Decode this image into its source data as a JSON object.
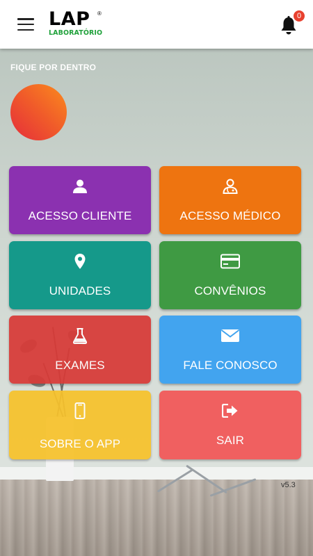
{
  "header": {
    "logo_main": "LAP",
    "logo_registered": "®",
    "logo_sub": "LABORATÓRIO",
    "notification_count": "0"
  },
  "section_title": "FIQUE POR DENTRO",
  "tiles": [
    {
      "label": "ACESSO CLIENTE",
      "icon": "user-icon",
      "color": "#8b31b0"
    },
    {
      "label": "ACESSO MÉDICO",
      "icon": "doctor-icon",
      "color": "#ee7410"
    },
    {
      "label": "UNIDADES",
      "icon": "map-marker-icon",
      "color": "#15998a"
    },
    {
      "label": "CONVÊNIOS",
      "icon": "credit-card-icon",
      "color": "#3f9a43"
    },
    {
      "label": "EXAMES",
      "icon": "flask-icon",
      "color": "#d83a37"
    },
    {
      "label": "FALE CONOSCO",
      "icon": "envelope-icon",
      "color": "#42a4ef"
    },
    {
      "label": "SOBRE O APP",
      "icon": "mobile-phone-icon",
      "color": "#f7c22b"
    },
    {
      "label": "SAIR",
      "icon": "sign-out-icon",
      "color": "#f25a5a"
    }
  ],
  "version": "v5.3"
}
